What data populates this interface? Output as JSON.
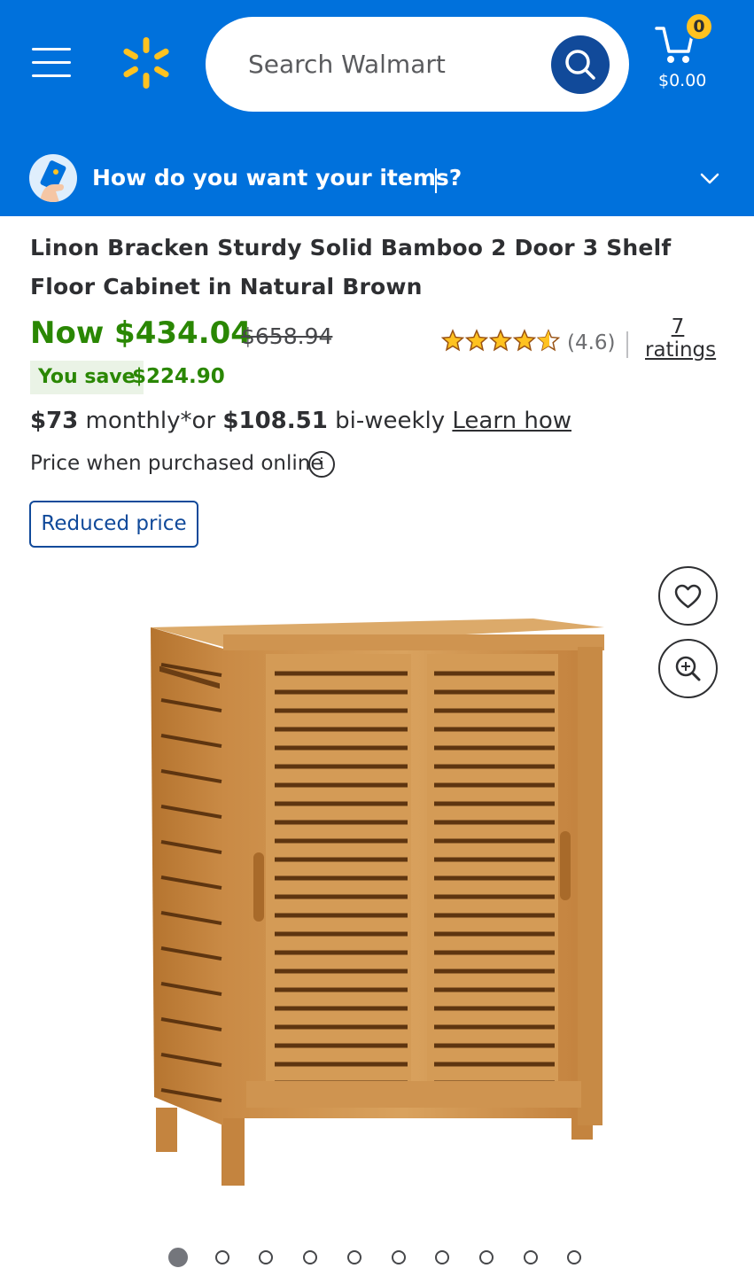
{
  "header": {
    "search_placeholder": "Search Walmart",
    "cart_count": "0",
    "cart_total": "$0.00",
    "brand_color": "#0071dc",
    "spark_color": "#ffc220"
  },
  "fulfillment": {
    "prompt": "How do you want your items?"
  },
  "product": {
    "title": "Linon Bracken Sturdy Solid Bamboo 2 Door 3 Shelf Floor Cabinet in Natural Brown",
    "price_now": "Now $434.04",
    "price_was": "$658.94",
    "rating": 4.6,
    "rating_text": "(4.6)",
    "ratings_count": "7",
    "ratings_label": "ratings",
    "save_label": "You save",
    "save_amount": "$224.90",
    "monthly_amount": "$73",
    "monthly_label": "monthly*or",
    "biweekly_amount": "$108.51",
    "biweekly_label": "bi-weekly",
    "learn_how": "Learn how",
    "price_note": "Price when purchased online",
    "info_glyph": "i",
    "badge": "Reduced price"
  },
  "gallery": {
    "image_count": 10,
    "active_index": 0
  }
}
